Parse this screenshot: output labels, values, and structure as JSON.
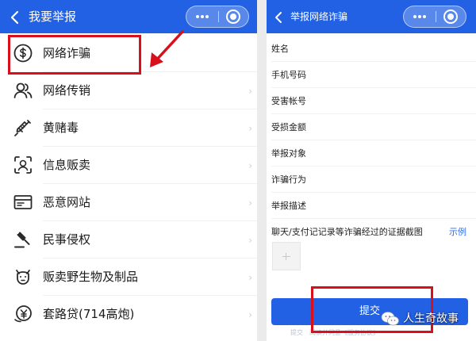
{
  "colors": {
    "brand_blue": "#2260e4",
    "highlight_red": "#d8101c",
    "link_blue": "#2a6ee8"
  },
  "left_panel": {
    "title": "我要举报",
    "menu": [
      {
        "label": "网络诈骗",
        "icon": "dollar-circle-icon"
      },
      {
        "label": "网络传销",
        "icon": "users-icon"
      },
      {
        "label": "黄赌毒",
        "icon": "syringe-icon"
      },
      {
        "label": "信息贩卖",
        "icon": "face-scan-icon"
      },
      {
        "label": "恶意网站",
        "icon": "browser-window-icon"
      },
      {
        "label": "民事侵权",
        "icon": "gavel-icon"
      },
      {
        "label": "贩卖野生物及制品",
        "icon": "animal-icon"
      },
      {
        "label": "套路贷(714高炮)",
        "icon": "yen-coin-icon"
      }
    ]
  },
  "right_panel": {
    "title": "举报网络诈骗",
    "fields": [
      "姓名",
      "手机号码",
      "受害帐号",
      "受损金额",
      "举报对象",
      "诈骗行为",
      "举报描述"
    ],
    "evidence_label": "聊天/支付记记录等诈骗经过的证据截图",
    "example_link": "示例",
    "submit_label": "提交",
    "footnote": "提交　阅读并同意《服务协议》"
  },
  "watermark": {
    "text": "人生奇故事"
  }
}
